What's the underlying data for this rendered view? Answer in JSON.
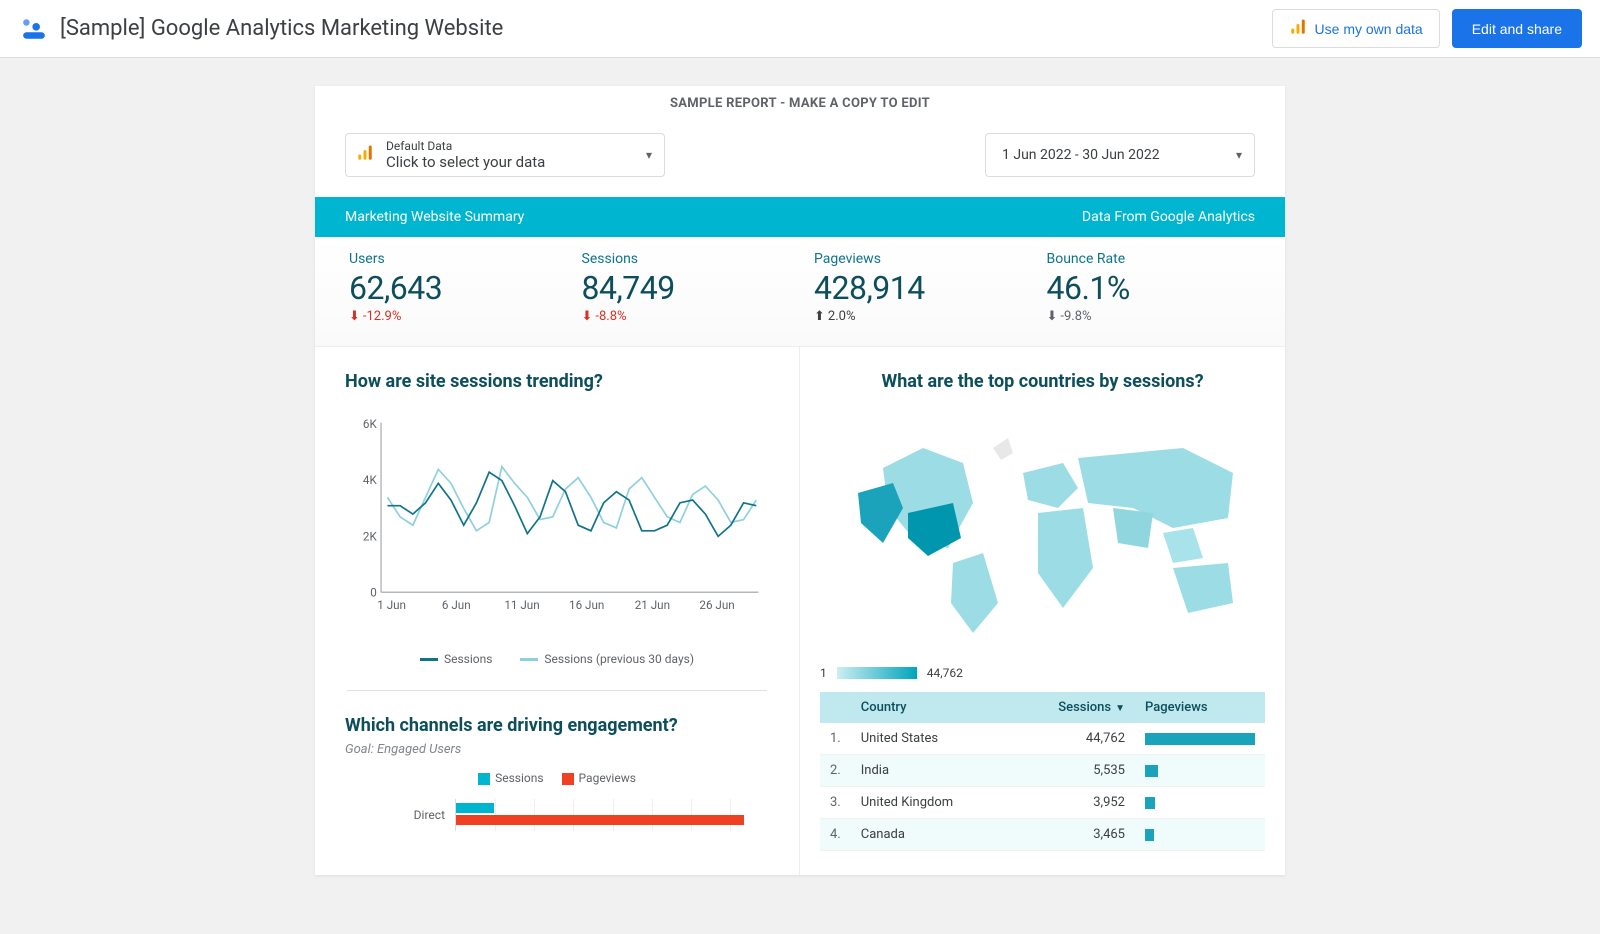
{
  "header": {
    "title": "[Sample] Google Analytics Marketing Website",
    "use_own_data": "Use my own data",
    "edit_share": "Edit and share"
  },
  "banner": "SAMPLE REPORT - MAKE A COPY TO EDIT",
  "data_source": {
    "line1": "Default Data",
    "line2": "Click to select your data"
  },
  "date_range": "1 Jun 2022 - 30 Jun 2022",
  "tealbar": {
    "left": "Marketing Website Summary",
    "right": "Data From Google Analytics"
  },
  "kpis": [
    {
      "label": "Users",
      "value": "62,643",
      "delta": "-12.9%",
      "dir": "down"
    },
    {
      "label": "Sessions",
      "value": "84,749",
      "delta": "-8.8%",
      "dir": "down"
    },
    {
      "label": "Pageviews",
      "value": "428,914",
      "delta": "2.0%",
      "dir": "up"
    },
    {
      "label": "Bounce Rate",
      "value": "46.1%",
      "delta": "-9.8%",
      "dir": "down-muted"
    }
  ],
  "sessions_chart_title": "How are site sessions trending?",
  "countries_chart_title": "What are the top countries by sessions?",
  "channels_title": "Which channels are driving engagement?",
  "channels_subtitle": "Goal: Engaged Users",
  "legend": {
    "current": "Sessions",
    "previous": "Sessions (previous 30 days)",
    "sessions": "Sessions",
    "pageviews": "Pageviews"
  },
  "map_scale": {
    "min": "1",
    "max": "44,762"
  },
  "country_headers": {
    "country": "Country",
    "sessions": "Sessions",
    "pageviews": "Pageviews"
  },
  "countries": [
    {
      "rank": "1.",
      "name": "United States",
      "sessions": "44,762",
      "barPct": 100
    },
    {
      "rank": "2.",
      "name": "India",
      "sessions": "5,535",
      "barPct": 12
    },
    {
      "rank": "3.",
      "name": "United Kingdom",
      "sessions": "3,952",
      "barPct": 9
    },
    {
      "rank": "4.",
      "name": "Canada",
      "sessions": "3,465",
      "barPct": 8
    }
  ],
  "channels": [
    {
      "name": "Direct",
      "sessionsPct": 12,
      "pageviewsPct": 92
    }
  ],
  "colors": {
    "teal": "#00b5d0",
    "darkteal": "#107489",
    "red": "#ef4023",
    "blue": "#1a73e8"
  },
  "chart_data": [
    {
      "type": "line",
      "title": "How are site sessions trending?",
      "xlabel": "",
      "ylabel": "",
      "ylim": [
        0,
        6000
      ],
      "y_ticks": [
        0,
        2000,
        4000,
        6000
      ],
      "x_ticks": [
        "1 Jun",
        "6 Jun",
        "11 Jun",
        "16 Jun",
        "21 Jun",
        "26 Jun"
      ],
      "x": [
        1,
        2,
        3,
        4,
        5,
        6,
        7,
        8,
        9,
        10,
        11,
        12,
        13,
        14,
        15,
        16,
        17,
        18,
        19,
        20,
        21,
        22,
        23,
        24,
        25,
        26,
        27,
        28,
        29,
        30
      ],
      "series": [
        {
          "name": "Sessions",
          "values": [
            3100,
            3100,
            2800,
            3200,
            3900,
            3300,
            2400,
            3200,
            4300,
            4000,
            3100,
            2100,
            2700,
            4000,
            3600,
            2400,
            2200,
            3200,
            3600,
            3300,
            2200,
            2200,
            2400,
            3200,
            3300,
            2800,
            2000,
            2400,
            3200,
            3100
          ]
        },
        {
          "name": "Sessions (previous 30 days)",
          "values": [
            3400,
            2700,
            2400,
            3400,
            4400,
            3900,
            3000,
            2200,
            2500,
            4500,
            3900,
            3400,
            2600,
            2700,
            3700,
            4100,
            3400,
            2500,
            2300,
            3700,
            4100,
            3400,
            2700,
            2500,
            3500,
            3800,
            3300,
            2500,
            2600,
            3300
          ]
        }
      ]
    },
    {
      "type": "map",
      "title": "What are the top countries by sessions?",
      "metric": "Sessions",
      "scale": [
        1,
        44762
      ],
      "data": [
        {
          "country": "United States",
          "value": 44762
        },
        {
          "country": "India",
          "value": 5535
        },
        {
          "country": "United Kingdom",
          "value": 3952
        },
        {
          "country": "Canada",
          "value": 3465
        }
      ]
    },
    {
      "type": "bar",
      "orientation": "horizontal",
      "title": "Which channels are driving engagement?",
      "categories": [
        "Direct"
      ],
      "series": [
        {
          "name": "Sessions",
          "values": [
            12
          ]
        },
        {
          "name": "Pageviews",
          "values": [
            92
          ]
        }
      ]
    }
  ]
}
